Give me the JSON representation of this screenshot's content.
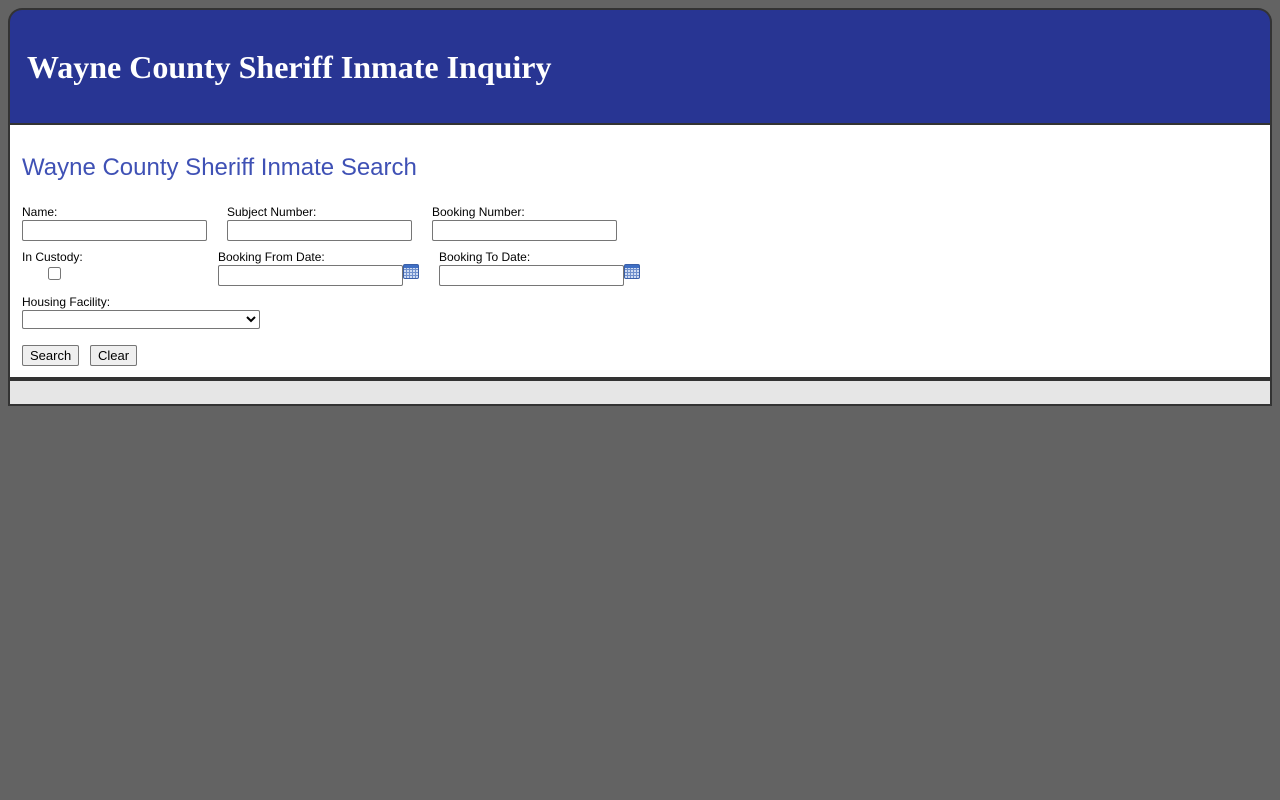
{
  "header": {
    "title": "Wayne County Sheriff Inmate Inquiry"
  },
  "search": {
    "heading": "Wayne County Sheriff Inmate Search",
    "name": {
      "label": "Name:",
      "value": ""
    },
    "subject_number": {
      "label": "Subject Number:",
      "value": ""
    },
    "booking_number": {
      "label": "Booking Number:",
      "value": ""
    },
    "in_custody": {
      "label": "In Custody:",
      "checked": false
    },
    "booking_from_date": {
      "label": "Booking From Date:",
      "value": "",
      "icon": "calendar-icon"
    },
    "booking_to_date": {
      "label": "Booking To Date:",
      "value": "",
      "icon": "calendar-icon"
    },
    "housing_facility": {
      "label": "Housing Facility:",
      "selected": ""
    },
    "search_button": "Search",
    "clear_button": "Clear"
  },
  "colors": {
    "background": "#636363",
    "header_bg": "#283593",
    "heading_text": "#3f51b5",
    "footer_bg": "#e6e6e6"
  }
}
